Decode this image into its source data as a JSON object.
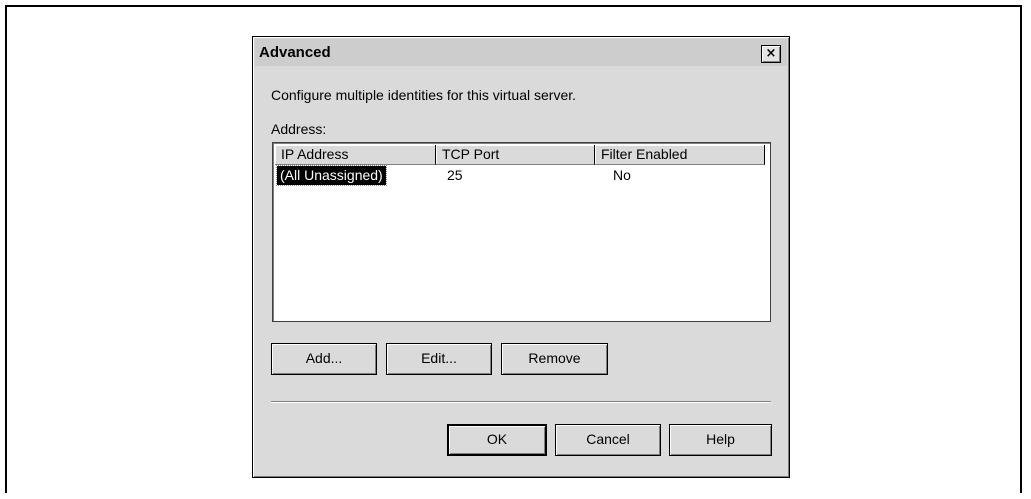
{
  "dialog": {
    "title": "Advanced",
    "close_label": "×",
    "description": "Configure multiple identities for this virtual server.",
    "address_label": "Address:"
  },
  "list": {
    "columns": [
      "IP Address",
      "TCP Port",
      "Filter Enabled"
    ],
    "rows": [
      {
        "ip": "(All Unassigned)",
        "port": "25",
        "filter": "No"
      }
    ]
  },
  "buttons": {
    "add": "Add...",
    "edit": "Edit...",
    "remove": "Remove",
    "ok": "OK",
    "cancel": "Cancel",
    "help": "Help"
  }
}
